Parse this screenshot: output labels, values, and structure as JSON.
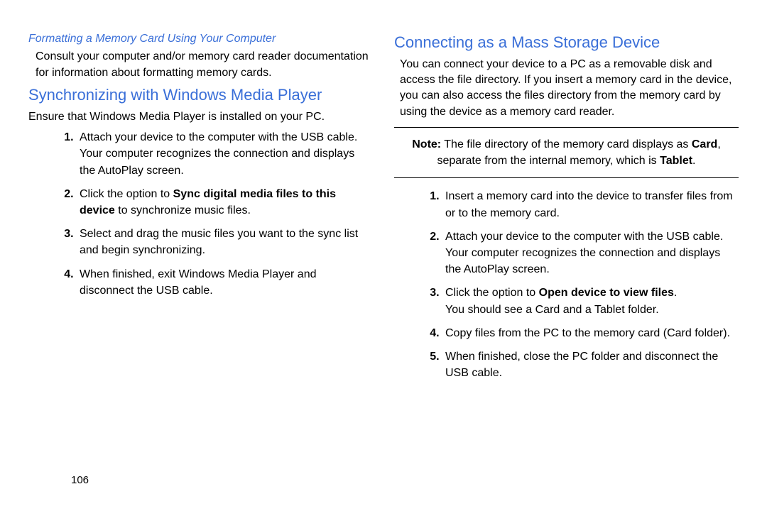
{
  "left": {
    "subhead": "Formatting a Memory Card Using Your Computer",
    "subhead_body": "Consult your computer and/or memory card reader documentation for information about formatting memory cards.",
    "heading": "Synchronizing with Windows Media Player",
    "intro": "Ensure that Windows Media Player is installed on your PC.",
    "steps": {
      "s1a": "Attach your device to the computer with the USB cable.",
      "s1b": "Your computer recognizes the connection and displays the AutoPlay screen.",
      "s2a": "Click the option to ",
      "s2bold": "Sync digital media files to this device",
      "s2b": " to synchronize music files.",
      "s3": "Select and drag the music files you want to the sync list and begin synchronizing.",
      "s4": "When finished, exit Windows Media Player and disconnect the USB cable."
    }
  },
  "right": {
    "heading": "Connecting as a Mass Storage Device",
    "intro": "You can connect your device to a PC as a removable disk and access the file directory. If you insert a memory card in the device, you can also access the files directory from the memory card by using the device as a memory card reader.",
    "note": {
      "label": "Note:",
      "t1": " The file directory of the memory card displays as ",
      "b1": "Card",
      "t2": ", separate from the internal memory, which is ",
      "b2": "Tablet",
      "t3": "."
    },
    "steps": {
      "s1": "Insert a memory card into the device to transfer files from or to the memory card.",
      "s2a": "Attach your device to the computer with the USB cable.",
      "s2b": "Your computer recognizes the connection and displays the AutoPlay screen.",
      "s3a": "Click the option to ",
      "s3bold": "Open device to view files",
      "s3b": ".",
      "s3c": "You should see a Card and a Tablet folder.",
      "s4": "Copy files from the PC to the memory card (Card folder).",
      "s5": "When finished, close the PC folder and disconnect the USB cable."
    }
  },
  "page_number": "106"
}
